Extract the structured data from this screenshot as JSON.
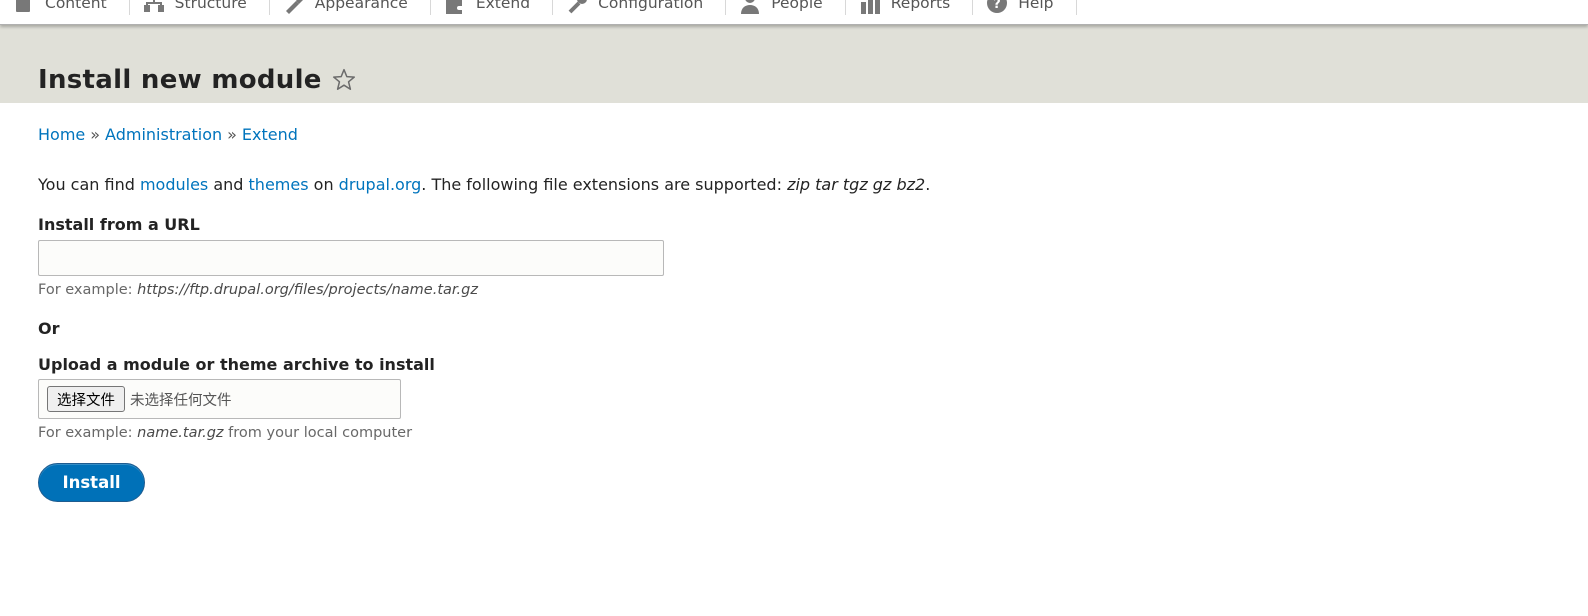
{
  "toolbar": {
    "items": [
      {
        "label": "Content",
        "icon": "content-icon"
      },
      {
        "label": "Structure",
        "icon": "structure-icon"
      },
      {
        "label": "Appearance",
        "icon": "appearance-icon"
      },
      {
        "label": "Extend",
        "icon": "extend-icon"
      },
      {
        "label": "Configuration",
        "icon": "configuration-icon"
      },
      {
        "label": "People",
        "icon": "people-icon"
      },
      {
        "label": "Reports",
        "icon": "reports-icon"
      },
      {
        "label": "Help",
        "icon": "help-icon"
      }
    ],
    "icon_color": "#787878"
  },
  "header": {
    "title": "Install new module",
    "background": "#e0e0d8"
  },
  "breadcrumb": {
    "items": [
      "Home",
      "Administration",
      "Extend"
    ],
    "separator": "»"
  },
  "intro": {
    "prefix": "You can find ",
    "link_modules": "modules",
    "and": " and ",
    "link_themes": "themes",
    "on": " on ",
    "link_drupal": "drupal.org",
    "suffix": ". The following file extensions are supported: ",
    "extensions": "zip tar tgz gz bz2",
    "end": "."
  },
  "url_section": {
    "label": "Install from a URL",
    "value": "",
    "desc_prefix": "For example: ",
    "desc_example": "https://ftp.drupal.org/files/projects/name.tar.gz"
  },
  "or_label": "Or",
  "upload_section": {
    "label": "Upload a module or theme archive to install",
    "button_label": "选择文件",
    "status": "未选择任何文件",
    "desc_prefix": "For example: ",
    "desc_example": "name.tar.gz",
    "desc_suffix": " from your local computer"
  },
  "install_button": {
    "label": "Install",
    "color": "#0071b8"
  },
  "link_color": "#0074bd"
}
